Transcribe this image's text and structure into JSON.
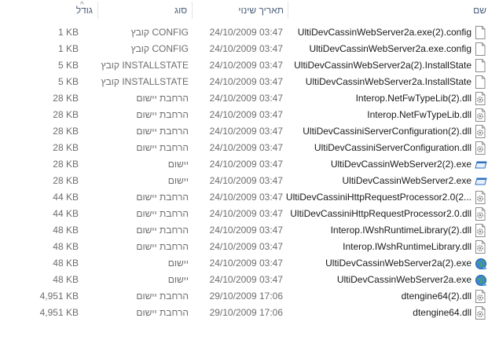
{
  "header": {
    "size": "גודל",
    "type": "סוג",
    "date": "תאריך שינוי",
    "name": "שם"
  },
  "files": [
    {
      "size": "1 KB",
      "type": "CONFIG קובץ",
      "date": "24/10/2009 03:47",
      "name": "UltiDevCassinWebServer2a.exe(2).config",
      "icon": "blank-file-icon"
    },
    {
      "size": "1 KB",
      "type": "CONFIG קובץ",
      "date": "24/10/2009 03:47",
      "name": "UltiDevCassinWebServer2a.exe.config",
      "icon": "blank-file-icon"
    },
    {
      "size": "5 KB",
      "type": "INSTALLSTATE קובץ",
      "date": "24/10/2009 03:47",
      "name": "UltiDevCassinWebServer2a(2).InstallState",
      "icon": "blank-file-icon"
    },
    {
      "size": "5 KB",
      "type": "INSTALLSTATE קובץ",
      "date": "24/10/2009 03:47",
      "name": "UltiDevCassinWebServer2a.InstallState",
      "icon": "blank-file-icon"
    },
    {
      "size": "28 KB",
      "type": "הרחבת יישום",
      "date": "24/10/2009 03:47",
      "name": "Interop.NetFwTypeLib(2).dll",
      "icon": "dll-gear-icon"
    },
    {
      "size": "28 KB",
      "type": "הרחבת יישום",
      "date": "24/10/2009 03:47",
      "name": "Interop.NetFwTypeLib.dll",
      "icon": "dll-gear-icon"
    },
    {
      "size": "28 KB",
      "type": "הרחבת יישום",
      "date": "24/10/2009 03:47",
      "name": "UltiDevCassiniServerConfiguration(2).dll",
      "icon": "dll-gear-icon"
    },
    {
      "size": "28 KB",
      "type": "הרחבת יישום",
      "date": "24/10/2009 03:47",
      "name": "UltiDevCassiniServerConfiguration.dll",
      "icon": "dll-gear-icon"
    },
    {
      "size": "28 KB",
      "type": "יישום",
      "date": "24/10/2009 03:47",
      "name": "UltiDevCassinWebServer2(2).exe",
      "icon": "app-window-icon"
    },
    {
      "size": "28 KB",
      "type": "יישום",
      "date": "24/10/2009 03:47",
      "name": "UltiDevCassinWebServer2.exe",
      "icon": "app-window-icon"
    },
    {
      "size": "44 KB",
      "type": "הרחבת יישום",
      "date": "24/10/2009 03:47",
      "name": "UltiDevCassiniHttpRequestProcessor2.0(2...",
      "icon": "dll-gear-icon"
    },
    {
      "size": "44 KB",
      "type": "הרחבת יישום",
      "date": "24/10/2009 03:47",
      "name": "UltiDevCassiniHttpRequestProcessor2.0.dll",
      "icon": "dll-gear-icon"
    },
    {
      "size": "48 KB",
      "type": "הרחבת יישום",
      "date": "24/10/2009 03:47",
      "name": "Interop.IWshRuntimeLibrary(2).dll",
      "icon": "dll-gear-icon"
    },
    {
      "size": "48 KB",
      "type": "הרחבת יישום",
      "date": "24/10/2009 03:47",
      "name": "Interop.IWshRuntimeLibrary.dll",
      "icon": "dll-gear-icon"
    },
    {
      "size": "48 KB",
      "type": "יישום",
      "date": "24/10/2009 03:47",
      "name": "UltiDevCassinWebServer2a(2).exe",
      "icon": "globe-app-icon"
    },
    {
      "size": "48 KB",
      "type": "יישום",
      "date": "24/10/2009 03:47",
      "name": "UltiDevCassinWebServer2a.exe",
      "icon": "globe-app-icon"
    },
    {
      "size": "4,951 KB",
      "type": "הרחבת יישום",
      "date": "29/10/2009 17:06",
      "name": "dtengine64(2).dll",
      "icon": "dll-gear-icon"
    },
    {
      "size": "4,951 KB",
      "type": "הרחבת יישום",
      "date": "29/10/2009 17:06",
      "name": "dtengine64.dll",
      "icon": "dll-gear-icon"
    }
  ]
}
